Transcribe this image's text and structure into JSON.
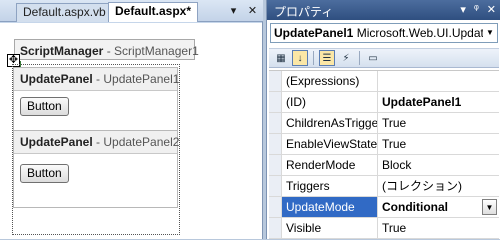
{
  "designer": {
    "tabs": [
      {
        "label": "Default.aspx.vb"
      },
      {
        "label": "Default.aspx*"
      }
    ],
    "toolbar": {
      "pin_glyph": "▾",
      "close_glyph": "✕"
    },
    "scriptmanager": {
      "type": "ScriptManager",
      "id": "ScriptManager1"
    },
    "updatepanels": [
      {
        "type": "UpdatePanel",
        "id": "UpdatePanel1",
        "button_label": "Button"
      },
      {
        "type": "UpdatePanel",
        "id": "UpdatePanel2",
        "button_label": "Button"
      }
    ],
    "separator": " - "
  },
  "properties": {
    "title": "プロパティ",
    "title_tools": {
      "dropdown": "▾",
      "pin": "ᵠ",
      "close": "✕"
    },
    "object_selector": {
      "name": "UpdatePanel1",
      "type": "Microsoft.Web.UI.Update"
    },
    "toolbar_icons": [
      "categorized-icon",
      "alphabetical-icon",
      "properties-icon",
      "events-icon",
      "property-pages-icon"
    ],
    "rows": [
      {
        "name": "(Expressions)",
        "value": "",
        "bold": false
      },
      {
        "name": "(ID)",
        "value": "UpdatePanel1",
        "bold": true
      },
      {
        "name": "ChildrenAsTriggers",
        "value": "True",
        "bold": false
      },
      {
        "name": "EnableViewState",
        "value": "True",
        "bold": false
      },
      {
        "name": "RenderMode",
        "value": "Block",
        "bold": false
      },
      {
        "name": "Triggers",
        "value": "(コレクション)",
        "bold": false
      },
      {
        "name": "UpdateMode",
        "value": "Conditional",
        "bold": true,
        "selected": true
      },
      {
        "name": "Visible",
        "value": "True",
        "bold": false
      }
    ],
    "selection_color": "#316ac5"
  }
}
